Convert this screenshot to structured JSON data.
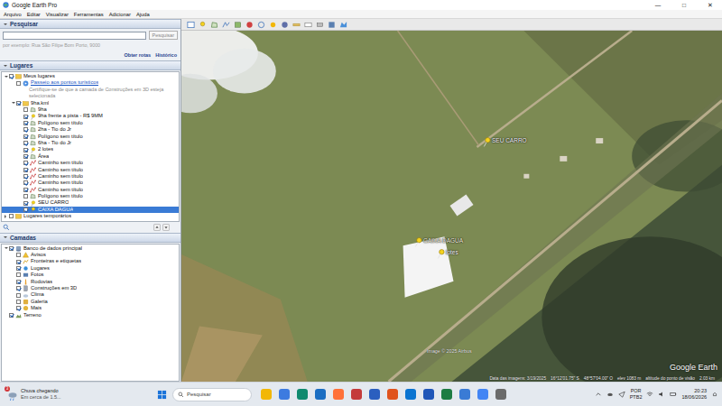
{
  "window": {
    "title": "Google Earth Pro",
    "controls": [
      "—",
      "□",
      "✕"
    ]
  },
  "menu": [
    "Arquivo",
    "Editar",
    "Visualizar",
    "Ferramentas",
    "Adicionar",
    "Ajuda"
  ],
  "search": {
    "header": "Pesquisar",
    "expanded": true,
    "value": "",
    "button": "Pesquisar",
    "hint": "por exemplo: Rua São Filipe Bom Porto, 9000",
    "links": [
      "Obter rotas",
      "Histórico"
    ]
  },
  "places": {
    "header": "Lugares",
    "expanded": true,
    "items": [
      {
        "label": "Meus lugares",
        "kind": "folder",
        "checked": true,
        "selected": false,
        "expanded": true,
        "children": [
          {
            "label": "Passeio aos pontos turísticos",
            "kind": "tour",
            "checked": false,
            "selected": false,
            "expanded": false,
            "note": "Certifique-se de que a camada de Construções em 3D esteja selecionada"
          },
          {
            "label": "9ha.kml",
            "kind": "folder",
            "checked": true,
            "selected": false,
            "expanded": true,
            "children": [
              {
                "label": "9ha",
                "kind": "polygon",
                "checked": false,
                "selected": false,
                "expanded": false
              },
              {
                "label": "9ha frente a pista - R$ 9MM",
                "kind": "placemark",
                "checked": true,
                "selected": false,
                "expanded": false
              },
              {
                "label": "Polígono sem título",
                "kind": "polygon",
                "checked": true,
                "selected": false,
                "expanded": false
              },
              {
                "label": "2ha - Tio do Jr",
                "kind": "polygon",
                "checked": true,
                "selected": false,
                "expanded": false
              },
              {
                "label": "Polígono sem título",
                "kind": "polygon",
                "checked": true,
                "selected": false,
                "expanded": false
              },
              {
                "label": "6ha - Tio do Jr",
                "kind": "polygon",
                "checked": true,
                "selected": false,
                "expanded": false
              },
              {
                "label": "2 lotes",
                "kind": "placemark",
                "checked": true,
                "selected": false,
                "expanded": false
              },
              {
                "label": "Área",
                "kind": "polygon",
                "checked": true,
                "selected": false,
                "expanded": false
              },
              {
                "label": "Caminho sem título",
                "kind": "path",
                "checked": true,
                "selected": false,
                "expanded": false
              },
              {
                "label": "Caminho sem título",
                "kind": "path",
                "checked": true,
                "selected": false,
                "expanded": false
              },
              {
                "label": "Caminho sem título",
                "kind": "path",
                "checked": true,
                "selected": false,
                "expanded": false
              },
              {
                "label": "Caminho sem título",
                "kind": "path",
                "checked": true,
                "selected": false,
                "expanded": false
              },
              {
                "label": "Caminho sem título",
                "kind": "path",
                "checked": true,
                "selected": false,
                "expanded": false
              },
              {
                "label": "Polígono sem título",
                "kind": "polygon",
                "checked": false,
                "selected": false,
                "expanded": false
              },
              {
                "label": "SEU CARRO",
                "kind": "placemark",
                "checked": true,
                "selected": false,
                "expanded": false
              },
              {
                "label": "CAIXA DAGUA",
                "kind": "placemark",
                "checked": true,
                "selected": true,
                "expanded": false
              }
            ]
          }
        ]
      },
      {
        "label": "Lugares temporários",
        "kind": "folder",
        "checked": false,
        "selected": false,
        "expanded": false
      }
    ]
  },
  "layers": {
    "header": "Camadas",
    "expanded": true,
    "items": [
      {
        "label": "Banco de dados principal",
        "kind": "folder",
        "checked": true,
        "selected": false,
        "expanded": true,
        "children": [
          {
            "label": "Avisos",
            "kind": "warning",
            "checked": false,
            "selected": false,
            "expanded": false
          },
          {
            "label": "Fronteiras e etiquetas",
            "kind": "borders",
            "checked": true,
            "selected": false,
            "expanded": false
          },
          {
            "label": "Lugares",
            "kind": "places",
            "checked": true,
            "selected": false,
            "expanded": false
          },
          {
            "label": "Fotos",
            "kind": "photos",
            "checked": false,
            "selected": false,
            "expanded": false
          },
          {
            "label": "Rodovias",
            "kind": "roads",
            "checked": true,
            "selected": false,
            "expanded": false
          },
          {
            "label": "Construções em 3D",
            "kind": "buildings",
            "checked": true,
            "selected": false,
            "expanded": false
          },
          {
            "label": "Clima",
            "kind": "weather",
            "checked": false,
            "selected": false,
            "expanded": false
          },
          {
            "label": "Galeria",
            "kind": "gallery",
            "checked": false,
            "selected": false,
            "expanded": false
          },
          {
            "label": "Mais",
            "kind": "more",
            "checked": true,
            "selected": false,
            "expanded": false
          }
        ]
      },
      {
        "label": "Terreno",
        "kind": "terrain",
        "checked": true,
        "selected": false,
        "expanded": false
      }
    ]
  },
  "map": {
    "placemarks": [
      {
        "label": "SEU CARRO",
        "selected": false
      },
      {
        "label": "CAIXA DAGUA",
        "selected": true
      },
      {
        "label": "lotes",
        "selected": false
      }
    ],
    "attribution": "Image © 2025 Airbus",
    "logo": "Google Earth",
    "status": [
      "Data das imagens: 3/19/2025",
      "16°12'01.75\" S",
      "48°57'04.00\" O",
      "elev  1083 m",
      "altitude do ponto de visão",
      "2.03 km"
    ]
  },
  "taskbar": {
    "weather": {
      "badge": "3",
      "title": "Chuva chegando",
      "subtitle": "Em cerca de 1.5..."
    },
    "search": {
      "placeholder": "Pesquisar"
    },
    "tray": {
      "language": "POR",
      "layout": "PTB2",
      "time": "20:23",
      "date": "18/06/2026"
    }
  }
}
